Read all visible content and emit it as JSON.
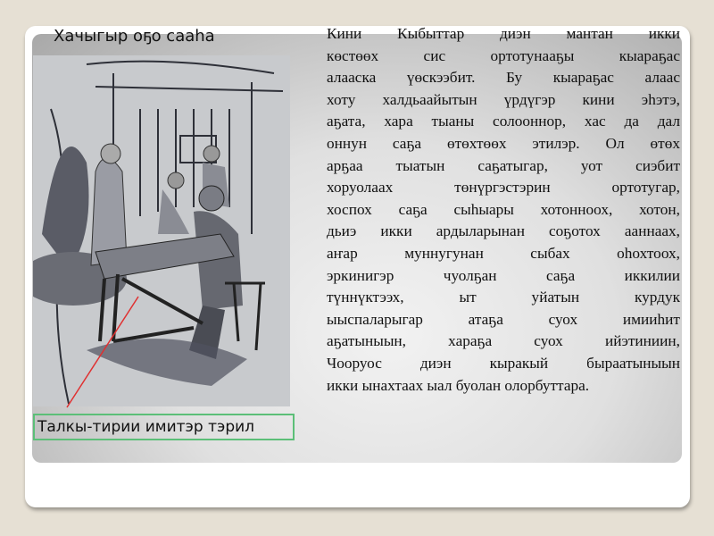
{
  "slide": {
    "title": "Хачыгыр оҕо сааһа",
    "caption": "Талкы-тирии имитэр тэрил",
    "body_lines": [
      "Кини Кыбыттар диэн мантан икки",
      "көстөөх сис ортотунааҕы кыараҕас",
      "алааска үөскээбит. Бу кыараҕас алаас",
      "хоту халдьаайытын үрдүгэр кини эһэтэ,",
      "аҕата, хара тыаны солооннор, хас да дал",
      "оннун саҕа өтөхтөөх этилэр. Ол өтөх",
      "арҕаа тыатын саҕатыгар, уот сиэбит",
      "хоруолаах төнүргэстэрин ортотугар,",
      "хоспох саҕа сыһыары хотонноох, хотон,",
      "дьиэ икки ардыларынан соҕотох ааннаах,",
      "аҥар муннугунан сыбах оһохтоох,",
      "эркинигэр чуолҕан саҕа иккилии",
      "түннүктээх, ыт уйатын курдук",
      "ыыспаларыгар атаҕа суох имииһит",
      "аҕатыныын, хараҕа суох ийэтиниин,",
      "Чооруос диэн кыракый быраатыныын",
      "икки ынахтаах ыал буолан олорбуттара."
    ]
  }
}
